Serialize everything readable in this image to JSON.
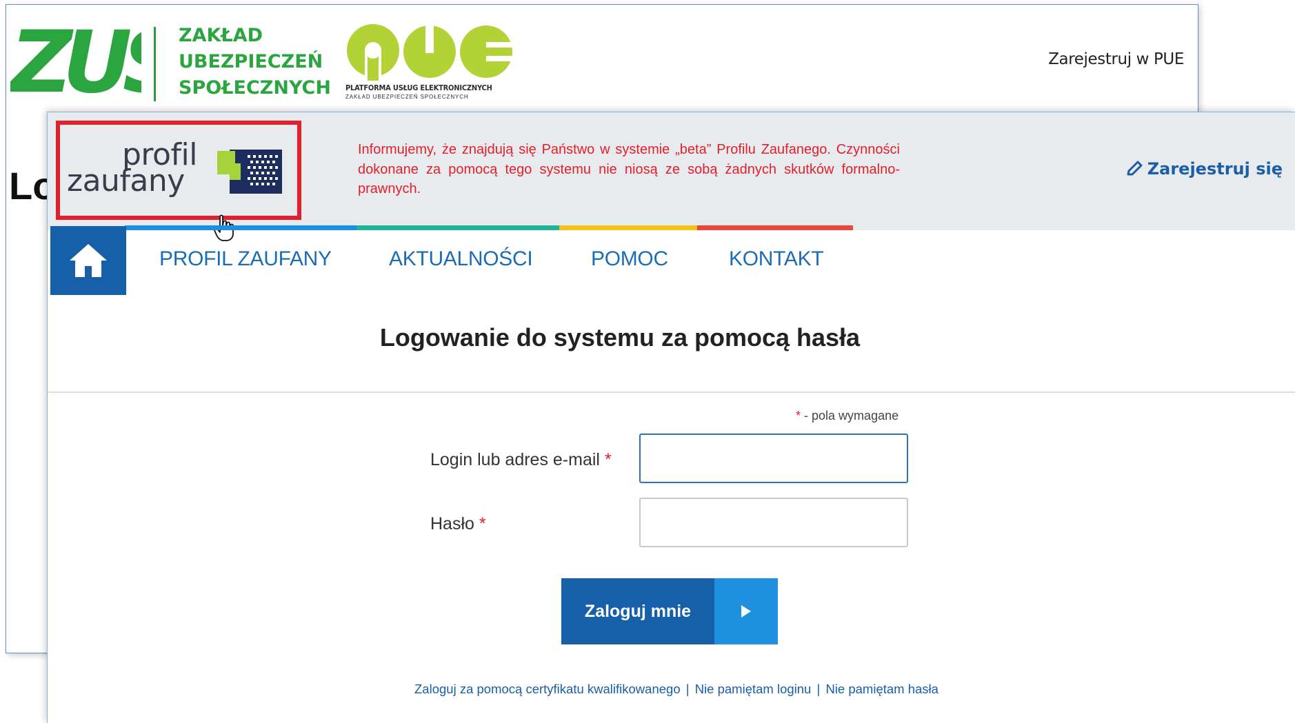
{
  "zus": {
    "logo_text": "ZUS",
    "name_lines": [
      "ZAKŁAD",
      "UBEZPIECZEŃ",
      "SPOŁECZNYCH"
    ],
    "pue_logo_text": "PUE",
    "pue_subtitle": "PLATFORMA USŁUG ELEKTRONICZNYCH",
    "pue_subtitle_small": "ZAKŁAD UBEZPIECZEŃ SPOŁECZNYCH",
    "register_link": "Zarejestruj w PUE",
    "partial_heading": "Lo",
    "colors": {
      "brand_green": "#2aa53f",
      "pue_lime": "#b3d235"
    }
  },
  "pz": {
    "logo_line1": "profil",
    "logo_line2": "zaufany",
    "notice": "Informujemy, że znajdują się Państwo w systemie „beta” Profilu Zaufanego. Czynności dokonane za pomocą tego systemu nie niosą ze sobą żadnych skutków formalno-prawnych.",
    "register_link": "Zarejestruj się",
    "nav": {
      "home_icon": "home-icon",
      "items": [
        "PROFIL ZAUFANY",
        "AKTUALNOŚCI",
        "POMOC",
        "KONTAKT"
      ]
    },
    "title": "Logowanie do systemu za pomocą hasła",
    "form": {
      "required_star": "*",
      "required_note": "- pola wymagane",
      "login_label": "Login lub adres e-mail",
      "login_value": "",
      "password_label": "Hasło",
      "password_value": "",
      "submit_label": "Zaloguj mnie"
    },
    "links": [
      "Zaloguj za pomocą certyfikatu kwalifikowanego",
      "Nie pamiętam loginu",
      "Nie pamiętam hasła"
    ],
    "link_separator": "|",
    "colors": {
      "primary_blue": "#1560a8",
      "accent_blue": "#1f8fe0",
      "notice_red": "#e41e2b",
      "bar_blue": "#1a8fe3",
      "bar_teal": "#1fb49a",
      "bar_yellow": "#f2c31a",
      "bar_red": "#e8473a"
    }
  }
}
